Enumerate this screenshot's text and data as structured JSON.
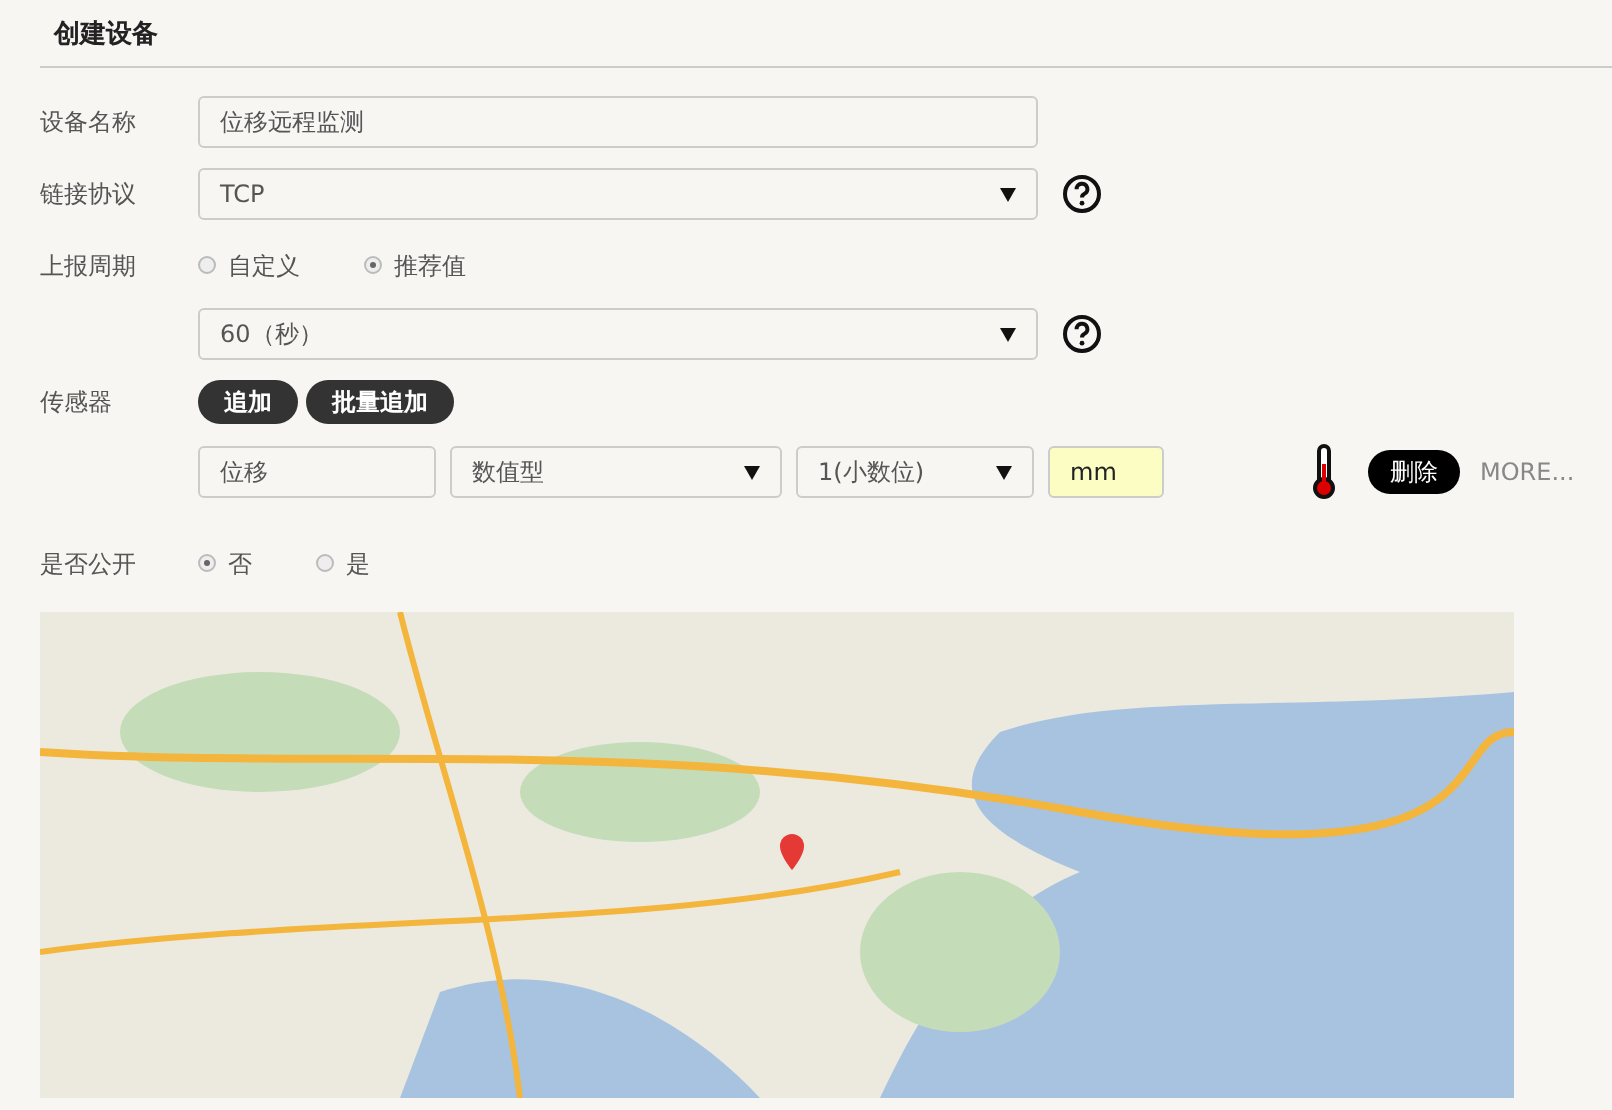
{
  "title": "创建设备",
  "fields": [
    {
      "kind": "text",
      "label": "设备名称",
      "value": "位移远程监测"
    },
    {
      "kind": "select",
      "label": "链接协议",
      "value": "TCP",
      "help": true
    },
    {
      "kind": "radio",
      "label": "上报周期",
      "options": [
        {
          "label": "自定义",
          "selected": false
        },
        {
          "label": "推荐值",
          "selected": true
        }
      ]
    },
    {
      "kind": "select",
      "value": "60（秒）",
      "help": true
    },
    {
      "kind": "buttons",
      "label": "传感器",
      "buttons": [
        "追加",
        "批量追加"
      ]
    },
    {
      "kind": "sensor",
      "name": "位移",
      "type": "数值型",
      "decimals": "1(小数位)",
      "unit": "mm",
      "delete": "删除",
      "more": "MORE..."
    },
    {
      "kind": "radio",
      "label": "是否公开",
      "options": [
        {
          "label": "否",
          "selected": true
        },
        {
          "label": "是",
          "selected": false
        }
      ]
    }
  ]
}
